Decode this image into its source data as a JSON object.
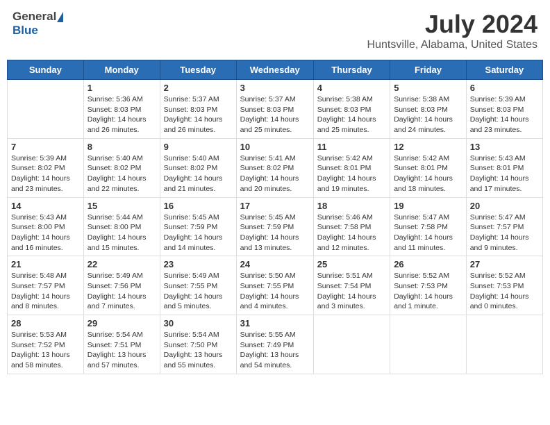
{
  "header": {
    "logo_general": "General",
    "logo_blue": "Blue",
    "title": "July 2024",
    "location": "Huntsville, Alabama, United States"
  },
  "days_of_week": [
    "Sunday",
    "Monday",
    "Tuesday",
    "Wednesday",
    "Thursday",
    "Friday",
    "Saturday"
  ],
  "weeks": [
    [
      {
        "day": "",
        "info": ""
      },
      {
        "day": "1",
        "info": "Sunrise: 5:36 AM\nSunset: 8:03 PM\nDaylight: 14 hours\nand 26 minutes."
      },
      {
        "day": "2",
        "info": "Sunrise: 5:37 AM\nSunset: 8:03 PM\nDaylight: 14 hours\nand 26 minutes."
      },
      {
        "day": "3",
        "info": "Sunrise: 5:37 AM\nSunset: 8:03 PM\nDaylight: 14 hours\nand 25 minutes."
      },
      {
        "day": "4",
        "info": "Sunrise: 5:38 AM\nSunset: 8:03 PM\nDaylight: 14 hours\nand 25 minutes."
      },
      {
        "day": "5",
        "info": "Sunrise: 5:38 AM\nSunset: 8:03 PM\nDaylight: 14 hours\nand 24 minutes."
      },
      {
        "day": "6",
        "info": "Sunrise: 5:39 AM\nSunset: 8:03 PM\nDaylight: 14 hours\nand 23 minutes."
      }
    ],
    [
      {
        "day": "7",
        "info": "Sunrise: 5:39 AM\nSunset: 8:02 PM\nDaylight: 14 hours\nand 23 minutes."
      },
      {
        "day": "8",
        "info": "Sunrise: 5:40 AM\nSunset: 8:02 PM\nDaylight: 14 hours\nand 22 minutes."
      },
      {
        "day": "9",
        "info": "Sunrise: 5:40 AM\nSunset: 8:02 PM\nDaylight: 14 hours\nand 21 minutes."
      },
      {
        "day": "10",
        "info": "Sunrise: 5:41 AM\nSunset: 8:02 PM\nDaylight: 14 hours\nand 20 minutes."
      },
      {
        "day": "11",
        "info": "Sunrise: 5:42 AM\nSunset: 8:01 PM\nDaylight: 14 hours\nand 19 minutes."
      },
      {
        "day": "12",
        "info": "Sunrise: 5:42 AM\nSunset: 8:01 PM\nDaylight: 14 hours\nand 18 minutes."
      },
      {
        "day": "13",
        "info": "Sunrise: 5:43 AM\nSunset: 8:01 PM\nDaylight: 14 hours\nand 17 minutes."
      }
    ],
    [
      {
        "day": "14",
        "info": "Sunrise: 5:43 AM\nSunset: 8:00 PM\nDaylight: 14 hours\nand 16 minutes."
      },
      {
        "day": "15",
        "info": "Sunrise: 5:44 AM\nSunset: 8:00 PM\nDaylight: 14 hours\nand 15 minutes."
      },
      {
        "day": "16",
        "info": "Sunrise: 5:45 AM\nSunset: 7:59 PM\nDaylight: 14 hours\nand 14 minutes."
      },
      {
        "day": "17",
        "info": "Sunrise: 5:45 AM\nSunset: 7:59 PM\nDaylight: 14 hours\nand 13 minutes."
      },
      {
        "day": "18",
        "info": "Sunrise: 5:46 AM\nSunset: 7:58 PM\nDaylight: 14 hours\nand 12 minutes."
      },
      {
        "day": "19",
        "info": "Sunrise: 5:47 AM\nSunset: 7:58 PM\nDaylight: 14 hours\nand 11 minutes."
      },
      {
        "day": "20",
        "info": "Sunrise: 5:47 AM\nSunset: 7:57 PM\nDaylight: 14 hours\nand 9 minutes."
      }
    ],
    [
      {
        "day": "21",
        "info": "Sunrise: 5:48 AM\nSunset: 7:57 PM\nDaylight: 14 hours\nand 8 minutes."
      },
      {
        "day": "22",
        "info": "Sunrise: 5:49 AM\nSunset: 7:56 PM\nDaylight: 14 hours\nand 7 minutes."
      },
      {
        "day": "23",
        "info": "Sunrise: 5:49 AM\nSunset: 7:55 PM\nDaylight: 14 hours\nand 5 minutes."
      },
      {
        "day": "24",
        "info": "Sunrise: 5:50 AM\nSunset: 7:55 PM\nDaylight: 14 hours\nand 4 minutes."
      },
      {
        "day": "25",
        "info": "Sunrise: 5:51 AM\nSunset: 7:54 PM\nDaylight: 14 hours\nand 3 minutes."
      },
      {
        "day": "26",
        "info": "Sunrise: 5:52 AM\nSunset: 7:53 PM\nDaylight: 14 hours\nand 1 minute."
      },
      {
        "day": "27",
        "info": "Sunrise: 5:52 AM\nSunset: 7:53 PM\nDaylight: 14 hours\nand 0 minutes."
      }
    ],
    [
      {
        "day": "28",
        "info": "Sunrise: 5:53 AM\nSunset: 7:52 PM\nDaylight: 13 hours\nand 58 minutes."
      },
      {
        "day": "29",
        "info": "Sunrise: 5:54 AM\nSunset: 7:51 PM\nDaylight: 13 hours\nand 57 minutes."
      },
      {
        "day": "30",
        "info": "Sunrise: 5:54 AM\nSunset: 7:50 PM\nDaylight: 13 hours\nand 55 minutes."
      },
      {
        "day": "31",
        "info": "Sunrise: 5:55 AM\nSunset: 7:49 PM\nDaylight: 13 hours\nand 54 minutes."
      },
      {
        "day": "",
        "info": ""
      },
      {
        "day": "",
        "info": ""
      },
      {
        "day": "",
        "info": ""
      }
    ]
  ]
}
